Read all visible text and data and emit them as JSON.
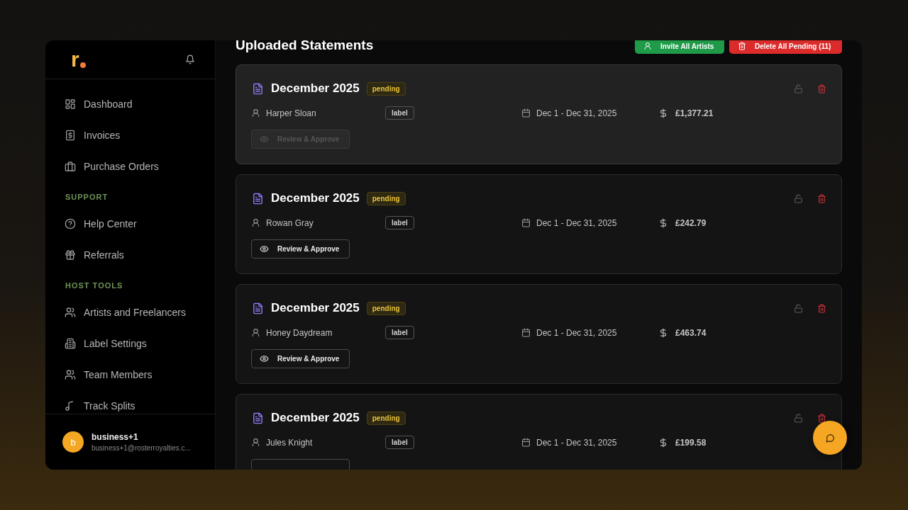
{
  "sidebar": {
    "logo": "r",
    "sections": [
      {
        "items": [
          {
            "label": "Dashboard",
            "selected": false
          },
          {
            "label": "Invoices",
            "selected": false
          },
          {
            "label": "Purchase Orders",
            "selected": false
          }
        ]
      },
      {
        "heading": "SUPPORT",
        "items": [
          {
            "label": "Help Center",
            "selected": false
          },
          {
            "label": "Referrals",
            "selected": false
          }
        ]
      },
      {
        "heading": "HOST TOOLS",
        "items": [
          {
            "label": "Artists and Freelancers",
            "selected": false
          },
          {
            "label": "Label Settings",
            "selected": false
          },
          {
            "label": "Team Members",
            "selected": false
          },
          {
            "label": "Track Splits",
            "selected": false
          }
        ]
      }
    ],
    "user": {
      "initial": "b",
      "name": "business+1",
      "email": "business+1@rosterroyalties.c..."
    }
  },
  "page": {
    "title": "Uploaded Statements",
    "actions": [
      {
        "label": "Invite All Artists",
        "kind": "invite"
      },
      {
        "label": "Delete All Pending (11)",
        "kind": "delete"
      }
    ]
  },
  "statements": [
    {
      "title": "December 2025",
      "status": "pending",
      "artist": "Harper Sloan",
      "tag": "label",
      "period": "Dec 1 - Dec 31, 2025",
      "amount": "£1,377.21",
      "highlighted": true,
      "review": {
        "label": "Review & Approve",
        "disabled": true
      }
    },
    {
      "title": "December 2025",
      "status": "pending",
      "artist": "Rowan Gray",
      "tag": "label",
      "period": "Dec 1 - Dec 31, 2025",
      "amount": "£242.79",
      "highlighted": false,
      "review": {
        "label": "Review & Approve",
        "disabled": false
      }
    },
    {
      "title": "December 2025",
      "status": "pending",
      "artist": "Honey Daydream",
      "tag": "label",
      "period": "Dec 1 - Dec 31, 2025",
      "amount": "£463.74",
      "highlighted": false,
      "review": {
        "label": "Review & Approve",
        "disabled": false
      }
    },
    {
      "title": "December 2025",
      "status": "pending",
      "artist": "Jules Knight",
      "tag": "label",
      "period": "Dec 1 - Dec 31, 2025",
      "amount": "£199.58",
      "highlighted": false,
      "review": {
        "disabled": false
      }
    }
  ]
}
